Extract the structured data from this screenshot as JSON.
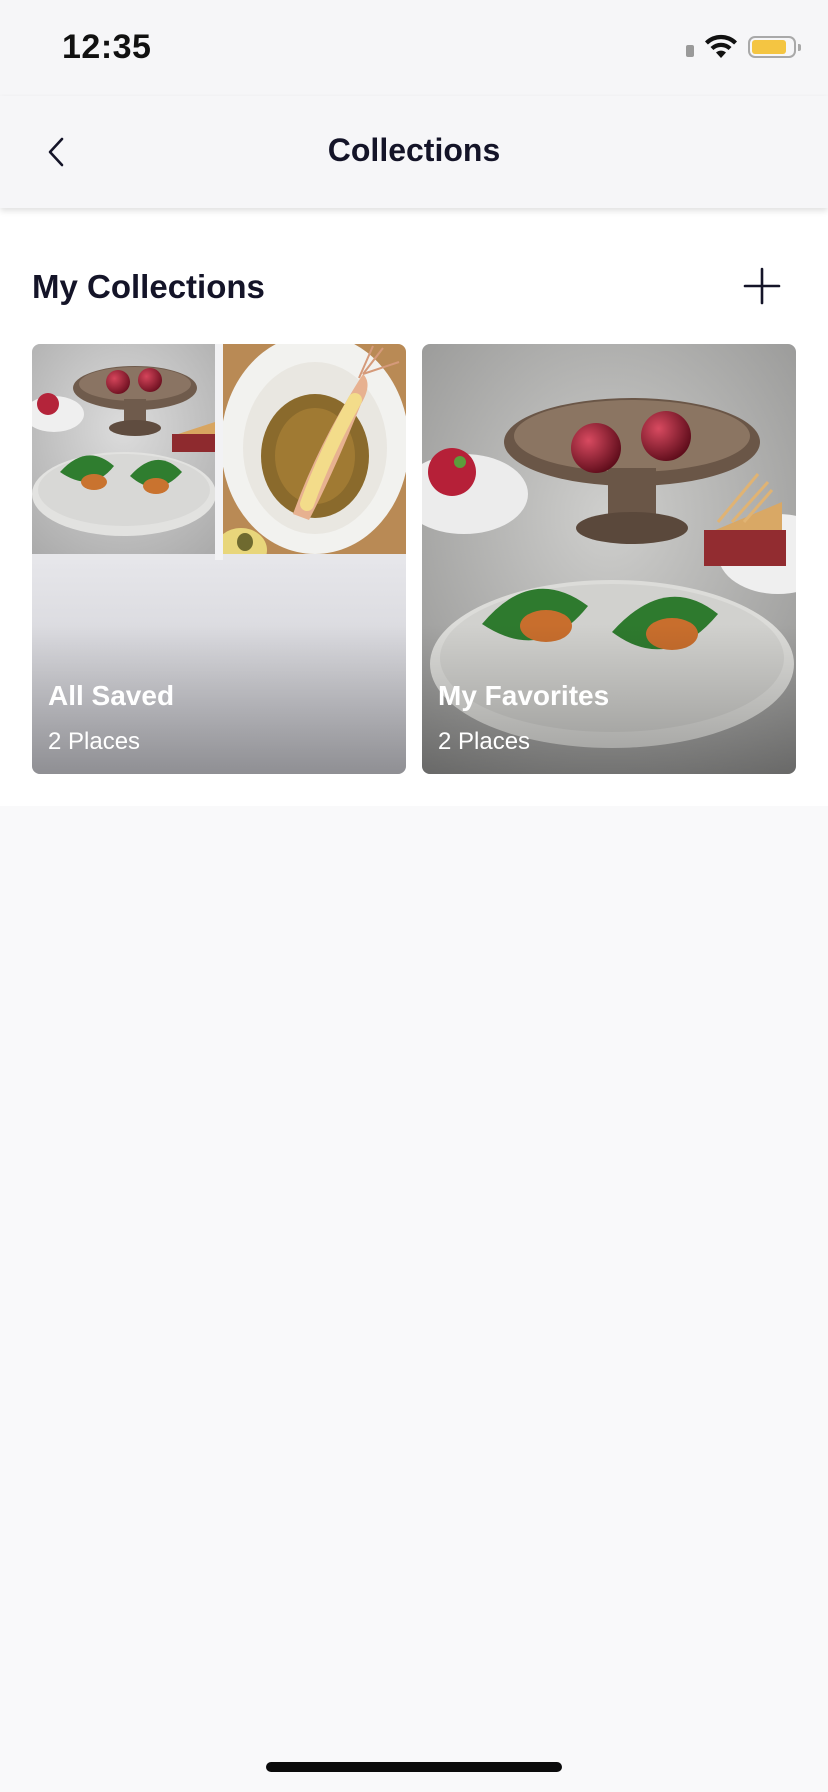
{
  "status_bar": {
    "time": "12:35",
    "icons": [
      "signal-icon",
      "wifi-icon",
      "battery-icon"
    ],
    "battery_color": "#f4c542",
    "battery_level": 0.84
  },
  "nav": {
    "title": "Collections",
    "back_icon": "chevron-left-icon"
  },
  "section": {
    "title": "My Collections",
    "add_icon": "plus-icon"
  },
  "collections": [
    {
      "name": "All Saved",
      "count": "2 Places"
    },
    {
      "name": "My Favorites",
      "count": "2 Places"
    }
  ],
  "colors": {
    "title_text": "#141428",
    "background": "#f9f9fa",
    "battery": "#f4c542"
  }
}
